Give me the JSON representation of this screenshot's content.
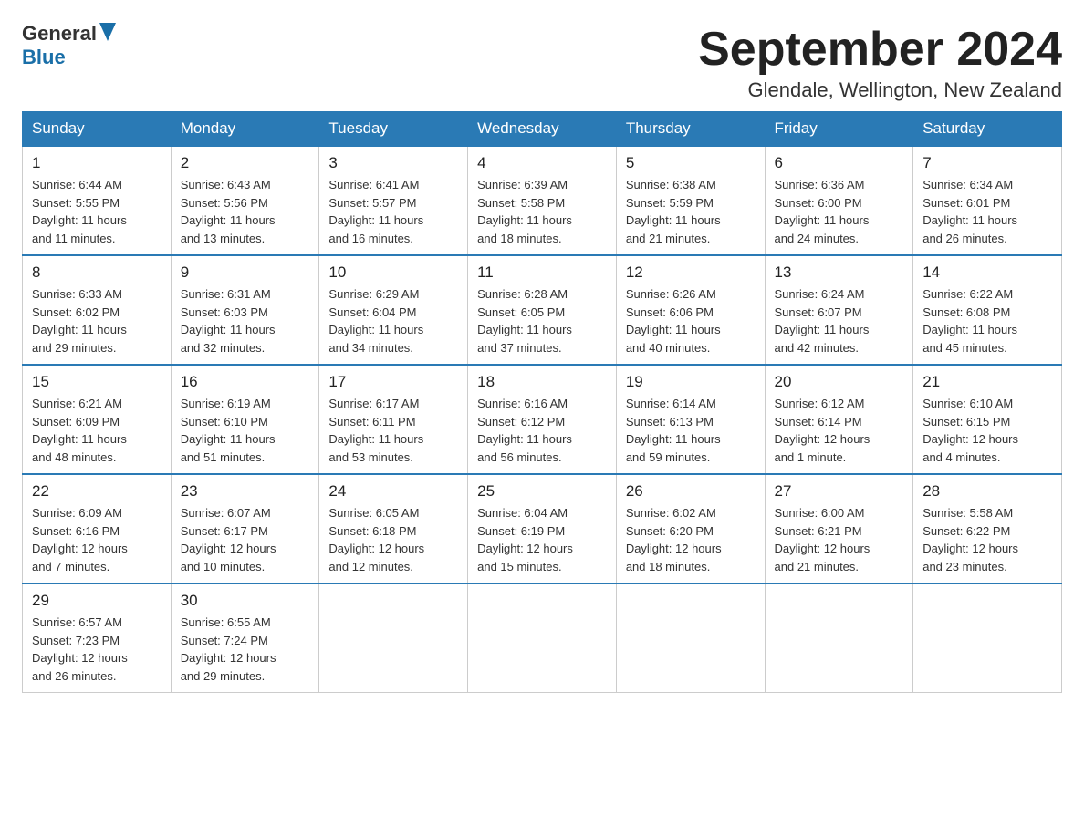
{
  "logo": {
    "name_part1": "General",
    "name_part2": "Blue"
  },
  "title": "September 2024",
  "subtitle": "Glendale, Wellington, New Zealand",
  "days_of_week": [
    "Sunday",
    "Monday",
    "Tuesday",
    "Wednesday",
    "Thursday",
    "Friday",
    "Saturday"
  ],
  "weeks": [
    [
      {
        "day": "1",
        "sunrise": "6:44 AM",
        "sunset": "5:55 PM",
        "daylight": "11 hours and 11 minutes."
      },
      {
        "day": "2",
        "sunrise": "6:43 AM",
        "sunset": "5:56 PM",
        "daylight": "11 hours and 13 minutes."
      },
      {
        "day": "3",
        "sunrise": "6:41 AM",
        "sunset": "5:57 PM",
        "daylight": "11 hours and 16 minutes."
      },
      {
        "day": "4",
        "sunrise": "6:39 AM",
        "sunset": "5:58 PM",
        "daylight": "11 hours and 18 minutes."
      },
      {
        "day": "5",
        "sunrise": "6:38 AM",
        "sunset": "5:59 PM",
        "daylight": "11 hours and 21 minutes."
      },
      {
        "day": "6",
        "sunrise": "6:36 AM",
        "sunset": "6:00 PM",
        "daylight": "11 hours and 24 minutes."
      },
      {
        "day": "7",
        "sunrise": "6:34 AM",
        "sunset": "6:01 PM",
        "daylight": "11 hours and 26 minutes."
      }
    ],
    [
      {
        "day": "8",
        "sunrise": "6:33 AM",
        "sunset": "6:02 PM",
        "daylight": "11 hours and 29 minutes."
      },
      {
        "day": "9",
        "sunrise": "6:31 AM",
        "sunset": "6:03 PM",
        "daylight": "11 hours and 32 minutes."
      },
      {
        "day": "10",
        "sunrise": "6:29 AM",
        "sunset": "6:04 PM",
        "daylight": "11 hours and 34 minutes."
      },
      {
        "day": "11",
        "sunrise": "6:28 AM",
        "sunset": "6:05 PM",
        "daylight": "11 hours and 37 minutes."
      },
      {
        "day": "12",
        "sunrise": "6:26 AM",
        "sunset": "6:06 PM",
        "daylight": "11 hours and 40 minutes."
      },
      {
        "day": "13",
        "sunrise": "6:24 AM",
        "sunset": "6:07 PM",
        "daylight": "11 hours and 42 minutes."
      },
      {
        "day": "14",
        "sunrise": "6:22 AM",
        "sunset": "6:08 PM",
        "daylight": "11 hours and 45 minutes."
      }
    ],
    [
      {
        "day": "15",
        "sunrise": "6:21 AM",
        "sunset": "6:09 PM",
        "daylight": "11 hours and 48 minutes."
      },
      {
        "day": "16",
        "sunrise": "6:19 AM",
        "sunset": "6:10 PM",
        "daylight": "11 hours and 51 minutes."
      },
      {
        "day": "17",
        "sunrise": "6:17 AM",
        "sunset": "6:11 PM",
        "daylight": "11 hours and 53 minutes."
      },
      {
        "day": "18",
        "sunrise": "6:16 AM",
        "sunset": "6:12 PM",
        "daylight": "11 hours and 56 minutes."
      },
      {
        "day": "19",
        "sunrise": "6:14 AM",
        "sunset": "6:13 PM",
        "daylight": "11 hours and 59 minutes."
      },
      {
        "day": "20",
        "sunrise": "6:12 AM",
        "sunset": "6:14 PM",
        "daylight": "12 hours and 1 minute."
      },
      {
        "day": "21",
        "sunrise": "6:10 AM",
        "sunset": "6:15 PM",
        "daylight": "12 hours and 4 minutes."
      }
    ],
    [
      {
        "day": "22",
        "sunrise": "6:09 AM",
        "sunset": "6:16 PM",
        "daylight": "12 hours and 7 minutes."
      },
      {
        "day": "23",
        "sunrise": "6:07 AM",
        "sunset": "6:17 PM",
        "daylight": "12 hours and 10 minutes."
      },
      {
        "day": "24",
        "sunrise": "6:05 AM",
        "sunset": "6:18 PM",
        "daylight": "12 hours and 12 minutes."
      },
      {
        "day": "25",
        "sunrise": "6:04 AM",
        "sunset": "6:19 PM",
        "daylight": "12 hours and 15 minutes."
      },
      {
        "day": "26",
        "sunrise": "6:02 AM",
        "sunset": "6:20 PM",
        "daylight": "12 hours and 18 minutes."
      },
      {
        "day": "27",
        "sunrise": "6:00 AM",
        "sunset": "6:21 PM",
        "daylight": "12 hours and 21 minutes."
      },
      {
        "day": "28",
        "sunrise": "5:58 AM",
        "sunset": "6:22 PM",
        "daylight": "12 hours and 23 minutes."
      }
    ],
    [
      {
        "day": "29",
        "sunrise": "6:57 AM",
        "sunset": "7:23 PM",
        "daylight": "12 hours and 26 minutes."
      },
      {
        "day": "30",
        "sunrise": "6:55 AM",
        "sunset": "7:24 PM",
        "daylight": "12 hours and 29 minutes."
      },
      null,
      null,
      null,
      null,
      null
    ]
  ],
  "labels": {
    "sunrise": "Sunrise:",
    "sunset": "Sunset:",
    "daylight": "Daylight:"
  }
}
